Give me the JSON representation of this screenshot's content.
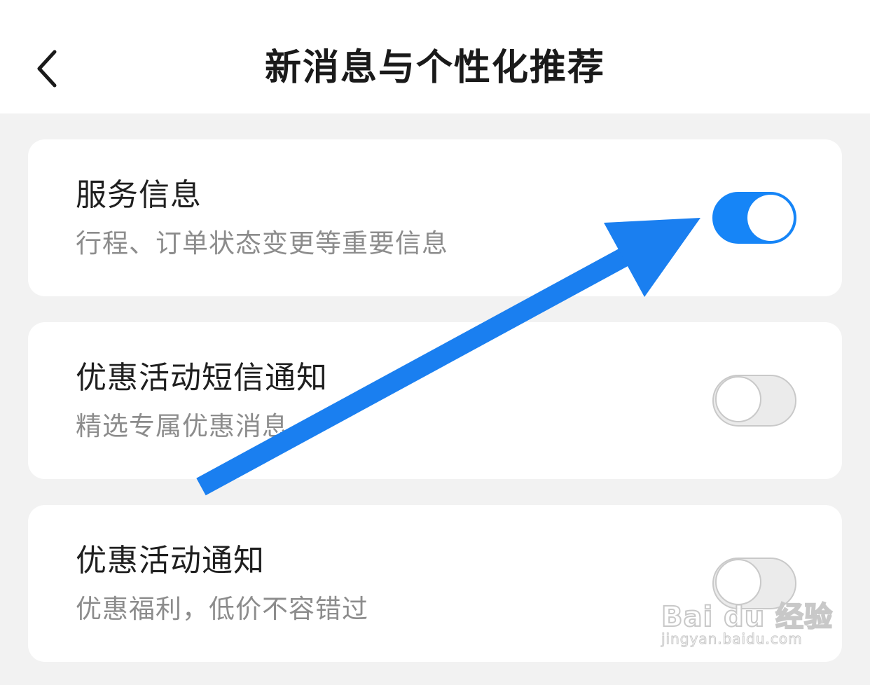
{
  "header": {
    "title": "新消息与个性化推荐",
    "back_icon": "chevron-left-icon"
  },
  "settings": [
    {
      "label": "服务信息",
      "description": "行程、订单状态变更等重要信息",
      "enabled": true
    },
    {
      "label": "优惠活动短信通知",
      "description": "精选专属优惠消息",
      "enabled": false
    },
    {
      "label": "优惠活动通知",
      "description": "优惠福利，低价不容错过",
      "enabled": false
    }
  ],
  "colors": {
    "toggle_on": "#1685f7",
    "toggle_off": "#ebebeb",
    "annotation_arrow": "#1a7ff0"
  },
  "watermark": {
    "brand": "Bai du 经验",
    "site": "jingyan.baidu.com"
  }
}
